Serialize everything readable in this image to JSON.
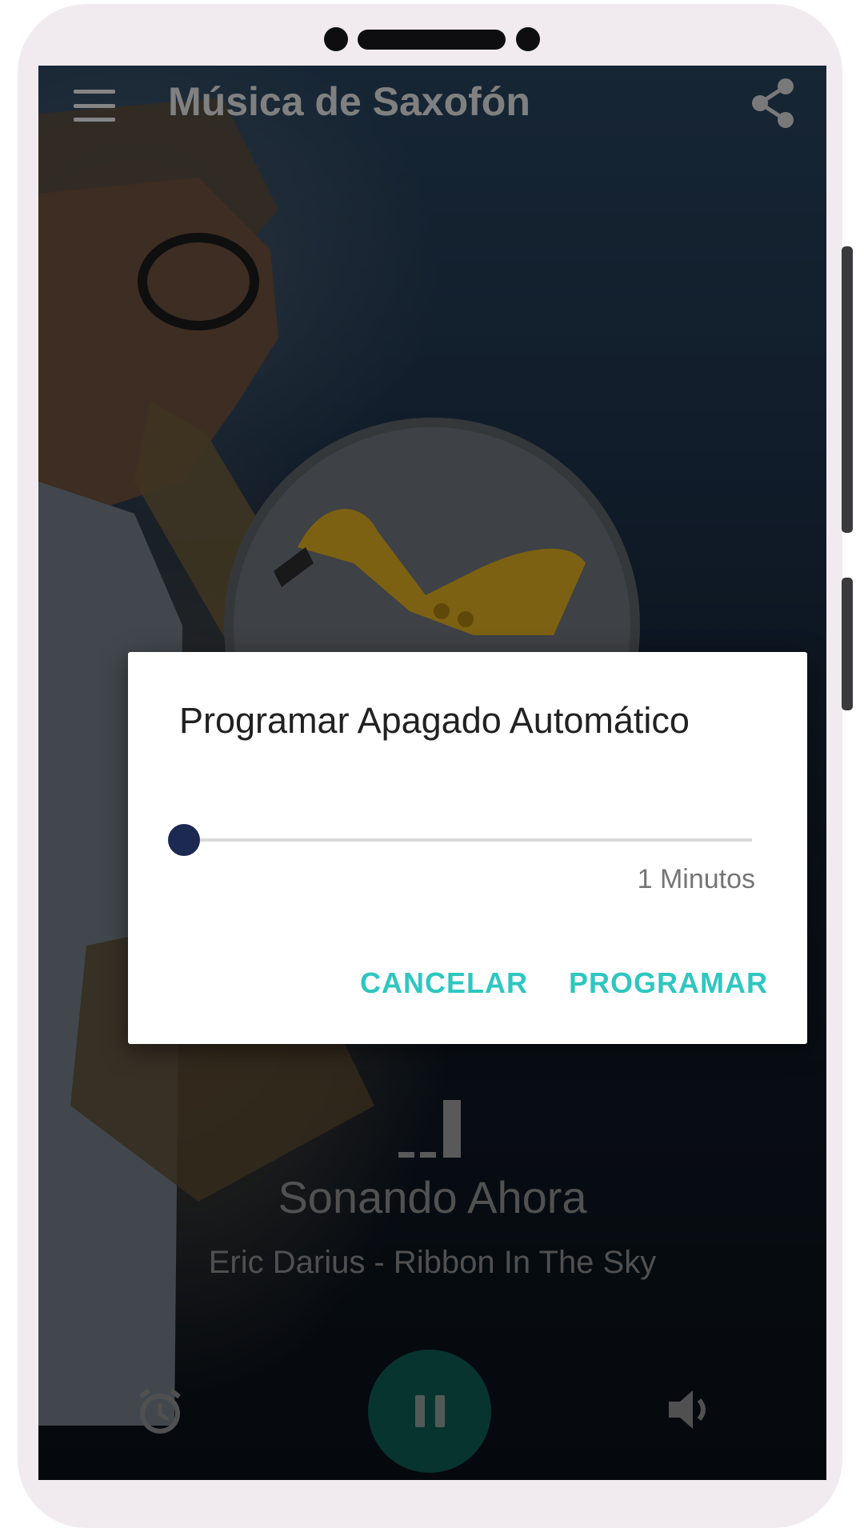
{
  "app_bar": {
    "title": "Música de Saxofón",
    "menu_icon": "hamburger-menu-icon",
    "share_icon": "share-icon"
  },
  "player": {
    "status_icon": "equalizer-icon",
    "now_playing_label": "Sonando Ahora",
    "track": "Eric Darius - Ribbon In The Sky",
    "controls": {
      "alarm_icon": "alarm-clock-icon",
      "play_pause_icon": "pause-icon",
      "volume_icon": "volume-icon"
    }
  },
  "dialog": {
    "title": "Programar Apagado Automático",
    "slider": {
      "value": 1,
      "value_label": "1 Minutos"
    },
    "cancel_label": "CANCELAR",
    "confirm_label": "PROGRAMAR"
  },
  "colors": {
    "accent": "#2ec7c0",
    "slider_thumb": "#1c2a52",
    "play_button": "#0f5a52"
  }
}
